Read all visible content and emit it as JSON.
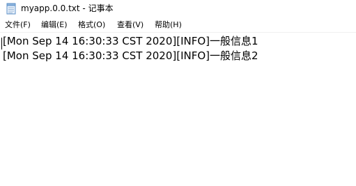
{
  "window": {
    "title": "myapp.0.0.txt - 记事本",
    "app_icon": "notepad-icon"
  },
  "menubar": {
    "items": [
      {
        "label": "文件(F)"
      },
      {
        "label": "编辑(E)"
      },
      {
        "label": "格式(O)"
      },
      {
        "label": "查看(V)"
      },
      {
        "label": "帮助(H)"
      }
    ]
  },
  "editor": {
    "lines": [
      "[Mon Sep 14 16:30:33 CST 2020][INFO]一般信息1",
      "[Mon Sep 14 16:30:33 CST 2020][INFO]一般信息2"
    ]
  },
  "colors": {
    "background": "#ffffff",
    "text": "#000000",
    "separator": "#f0f0f0"
  }
}
